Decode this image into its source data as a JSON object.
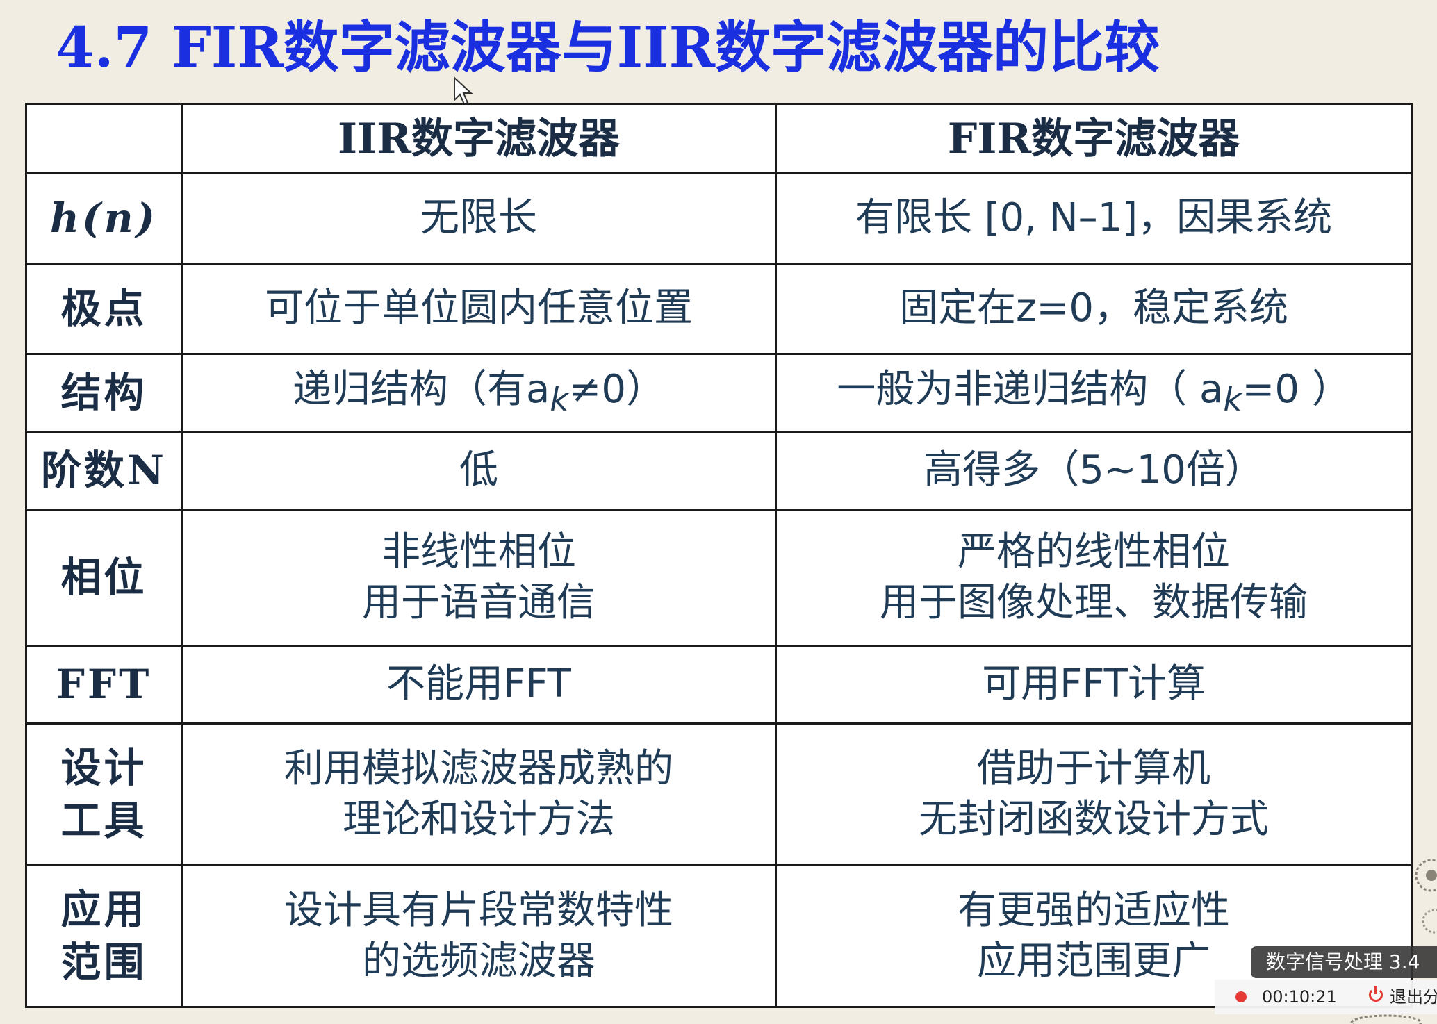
{
  "slide": {
    "title": "4.7  FIR数字滤波器与IIR数字滤波器的比较",
    "header": {
      "corner": "",
      "iir": "IIR数字滤波器",
      "fir": "FIR数字滤波器"
    },
    "rows": [
      {
        "label_lines": [
          "h(n)"
        ],
        "iir_lines": [
          "无限长"
        ],
        "fir_lines": [
          "有限长 [0, N–1]，因果系统"
        ]
      },
      {
        "label_lines": [
          "极点"
        ],
        "iir_lines": [
          "可位于单位圆内任意位置"
        ],
        "fir_lines": [
          "固定在z=0，稳定系统"
        ]
      },
      {
        "label_lines": [
          "结构"
        ],
        "iir_lines": [
          "递归结构（有a",
          "k",
          "≠0）"
        ],
        "fir_lines": [
          "一般为非递归结构（ a",
          "k",
          "=0 ）"
        ]
      },
      {
        "label_lines": [
          "阶数N"
        ],
        "iir_lines": [
          "低"
        ],
        "fir_lines": [
          "高得多（5~10倍）"
        ]
      },
      {
        "label_lines": [
          "相位"
        ],
        "iir_lines": [
          "非线性相位",
          "用于语音通信"
        ],
        "fir_lines": [
          "严格的线性相位",
          "用于图像处理、数据传输"
        ]
      },
      {
        "label_lines": [
          "FFT"
        ],
        "iir_lines": [
          "不能用FFT"
        ],
        "fir_lines": [
          "可用FFT计算"
        ]
      },
      {
        "label_lines": [
          "设计",
          "工具"
        ],
        "iir_lines": [
          "利用模拟滤波器成熟的",
          "理论和设计方法"
        ],
        "fir_lines": [
          "借助于计算机",
          "无封闭函数设计方式"
        ]
      },
      {
        "label_lines": [
          "应用",
          "范围"
        ],
        "iir_lines": [
          "设计具有片段常数特性",
          "的选频滤波器"
        ],
        "fir_lines": [
          "有更强的适应性",
          "应用范围更广"
        ]
      }
    ]
  },
  "player": {
    "video_title": "数字信号处理 3.4",
    "timer": "00:10:21",
    "exit_label": "退出分"
  },
  "colors": {
    "title": "#1a2fe0",
    "cell_text": "#1f3b56",
    "background": "#f1ede3",
    "record": "#e53935"
  }
}
